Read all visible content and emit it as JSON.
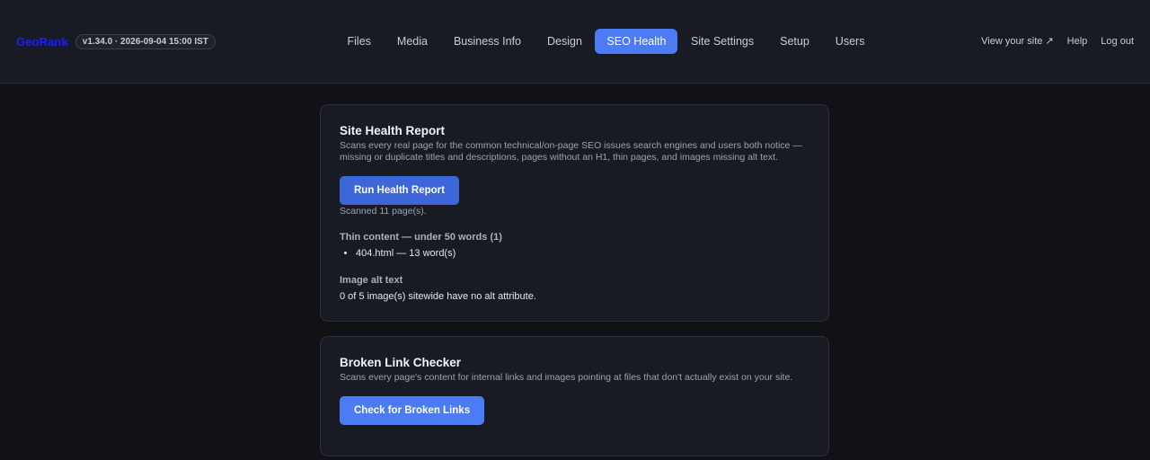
{
  "header": {
    "brand": "GeoRank",
    "version": "v1.34.0 · 2026-09-04 15:00 IST",
    "nav": [
      {
        "label": "Files"
      },
      {
        "label": "Media"
      },
      {
        "label": "Business Info"
      },
      {
        "label": "Design"
      },
      {
        "label": "SEO Health"
      },
      {
        "label": "Site Settings"
      },
      {
        "label": "Setup"
      },
      {
        "label": "Users"
      }
    ],
    "active_nav": "SEO Health",
    "right_links": {
      "view_site": "View your site ↗",
      "help": "Help",
      "logout": "Log out"
    }
  },
  "health_report": {
    "title": "Site Health Report",
    "description": "Scans every real page for the common technical/on-page SEO issues search engines and users both notice — missing or duplicate titles and descriptions, pages without an H1, thin pages, and images missing alt text.",
    "button_label": "Run Health Report",
    "scan_status": "Scanned 11 page(s).",
    "thin_content_heading": "Thin content — under 50 words (1)",
    "thin_content_items": [
      "404.html — 13 word(s)"
    ],
    "alt_text_heading": "Image alt text",
    "alt_text_result": "0 of 5 image(s) sitewide have no alt attribute."
  },
  "broken_links": {
    "title": "Broken Link Checker",
    "description": "Scans every page's content for internal links and images pointing at files that don't actually exist on your site.",
    "button_label": "Check for Broken Links"
  },
  "colors": {
    "accent": "#4b7cf3",
    "brand": "#1d1dff",
    "background": "#111215",
    "surface": "#181b24"
  }
}
